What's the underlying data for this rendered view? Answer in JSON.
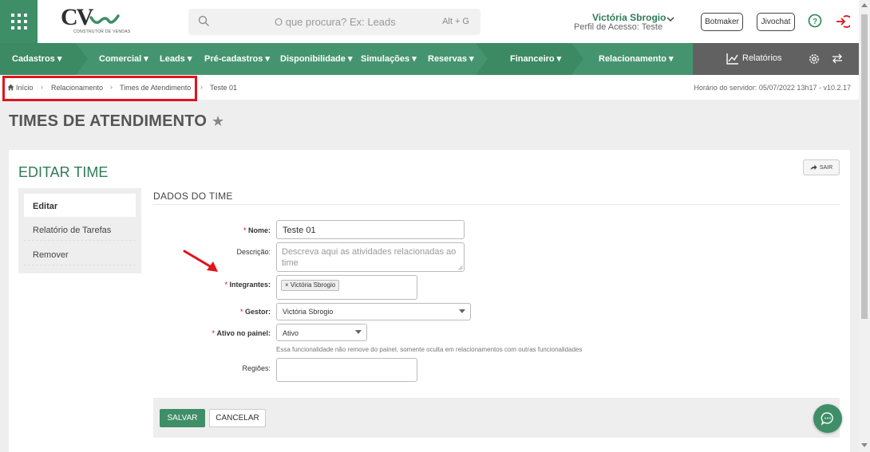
{
  "header": {
    "logo_text": "CV",
    "logo_sub": "CONSTRUTOR DE VENDAS",
    "search_placeholder": "O que procura? Ex: Leads",
    "search_shortcut": "Alt + G",
    "user_name": "Victória Sbrogio",
    "user_profile": "Perfil de Acesso: Teste",
    "botmaker_label": "Botmaker",
    "jivochat_label": "Jivochat"
  },
  "nav": {
    "items": [
      "Cadastros",
      "Comercial",
      "Leads",
      "Pré-cadastros",
      "Disponibilidade",
      "Simulações",
      "Reservas",
      "Financeiro",
      "Relacionamento"
    ],
    "reports_label": "Relatórios"
  },
  "breadcrumb": {
    "items": [
      "Início",
      "Relacionamento",
      "Times de Atendimento",
      "Teste 01"
    ],
    "server_time": "Horário do servidor: 05/07/2022 13h17 - v10.2.17"
  },
  "page": {
    "title": "TIMES DE ATENDIMENTO",
    "edit_title": "EDITAR TIME",
    "exit_label": "SAIR"
  },
  "sidebar": {
    "items": [
      "Editar",
      "Relatório de Tarefas",
      "Remover"
    ]
  },
  "form": {
    "section_title": "DADOS DO TIME",
    "nome_label": "Nome:",
    "nome_value": "Teste 01",
    "descricao_label": "Descrição:",
    "descricao_placeholder": "Descreva aqui as atividades relacionadas ao time",
    "integrantes_label": "Integrantes:",
    "integrantes_tags": [
      "Victória Sbrogio"
    ],
    "gestor_label": "Gestor:",
    "gestor_value": "Victória Sbrogio",
    "ativo_label": "Ativo no painel:",
    "ativo_value": "Ativo",
    "ativo_hint": "Essa funcionalidade não remove do painel, somente oculta em relacionamentos com outras funcionalidades",
    "regioes_label": "Regiões:",
    "regioes_value": "",
    "required_mark": "*",
    "save_label": "SALVAR",
    "cancel_label": "CANCELAR"
  },
  "colors": {
    "brand_green": "#3e8e67",
    "highlight_red": "#e0141b"
  }
}
